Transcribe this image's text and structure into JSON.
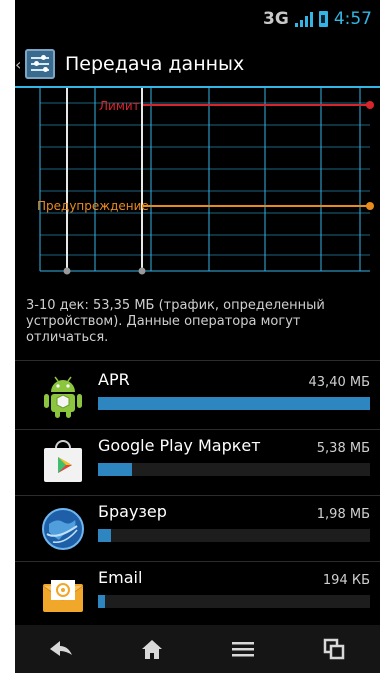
{
  "status": {
    "network": "3G",
    "time": "4:57",
    "signal_icon": "signal-icon",
    "battery_icon": "battery-charging-icon"
  },
  "header": {
    "title": "Передача данных",
    "icon": "data-usage-icon"
  },
  "chart": {
    "limit_label": "Лимит",
    "warning_label": "Предупреждение",
    "limit_color": "#d9242c",
    "warning_color": "#e98a1e"
  },
  "summary": "3-10 дек: 53,35 МБ (трафик, определенный устройством). Данные оператора могут отличаться.",
  "apps": [
    {
      "name": "APR",
      "size": "43,40 МБ",
      "fraction": 1.0,
      "icon": "android-robot-icon"
    },
    {
      "name": "Google Play Маркет",
      "size": "5,38 МБ",
      "fraction": 0.124,
      "icon": "play-store-icon"
    },
    {
      "name": "Браузер",
      "size": "1,98 МБ",
      "fraction": 0.046,
      "icon": "browser-globe-icon"
    },
    {
      "name": "Email",
      "size": "194 КБ",
      "fraction": 0.0045,
      "icon": "email-envelope-icon"
    }
  ],
  "nav": [
    "back-icon",
    "home-icon",
    "menu-icon",
    "recent-apps-icon"
  ],
  "accent": "#33b5e5"
}
